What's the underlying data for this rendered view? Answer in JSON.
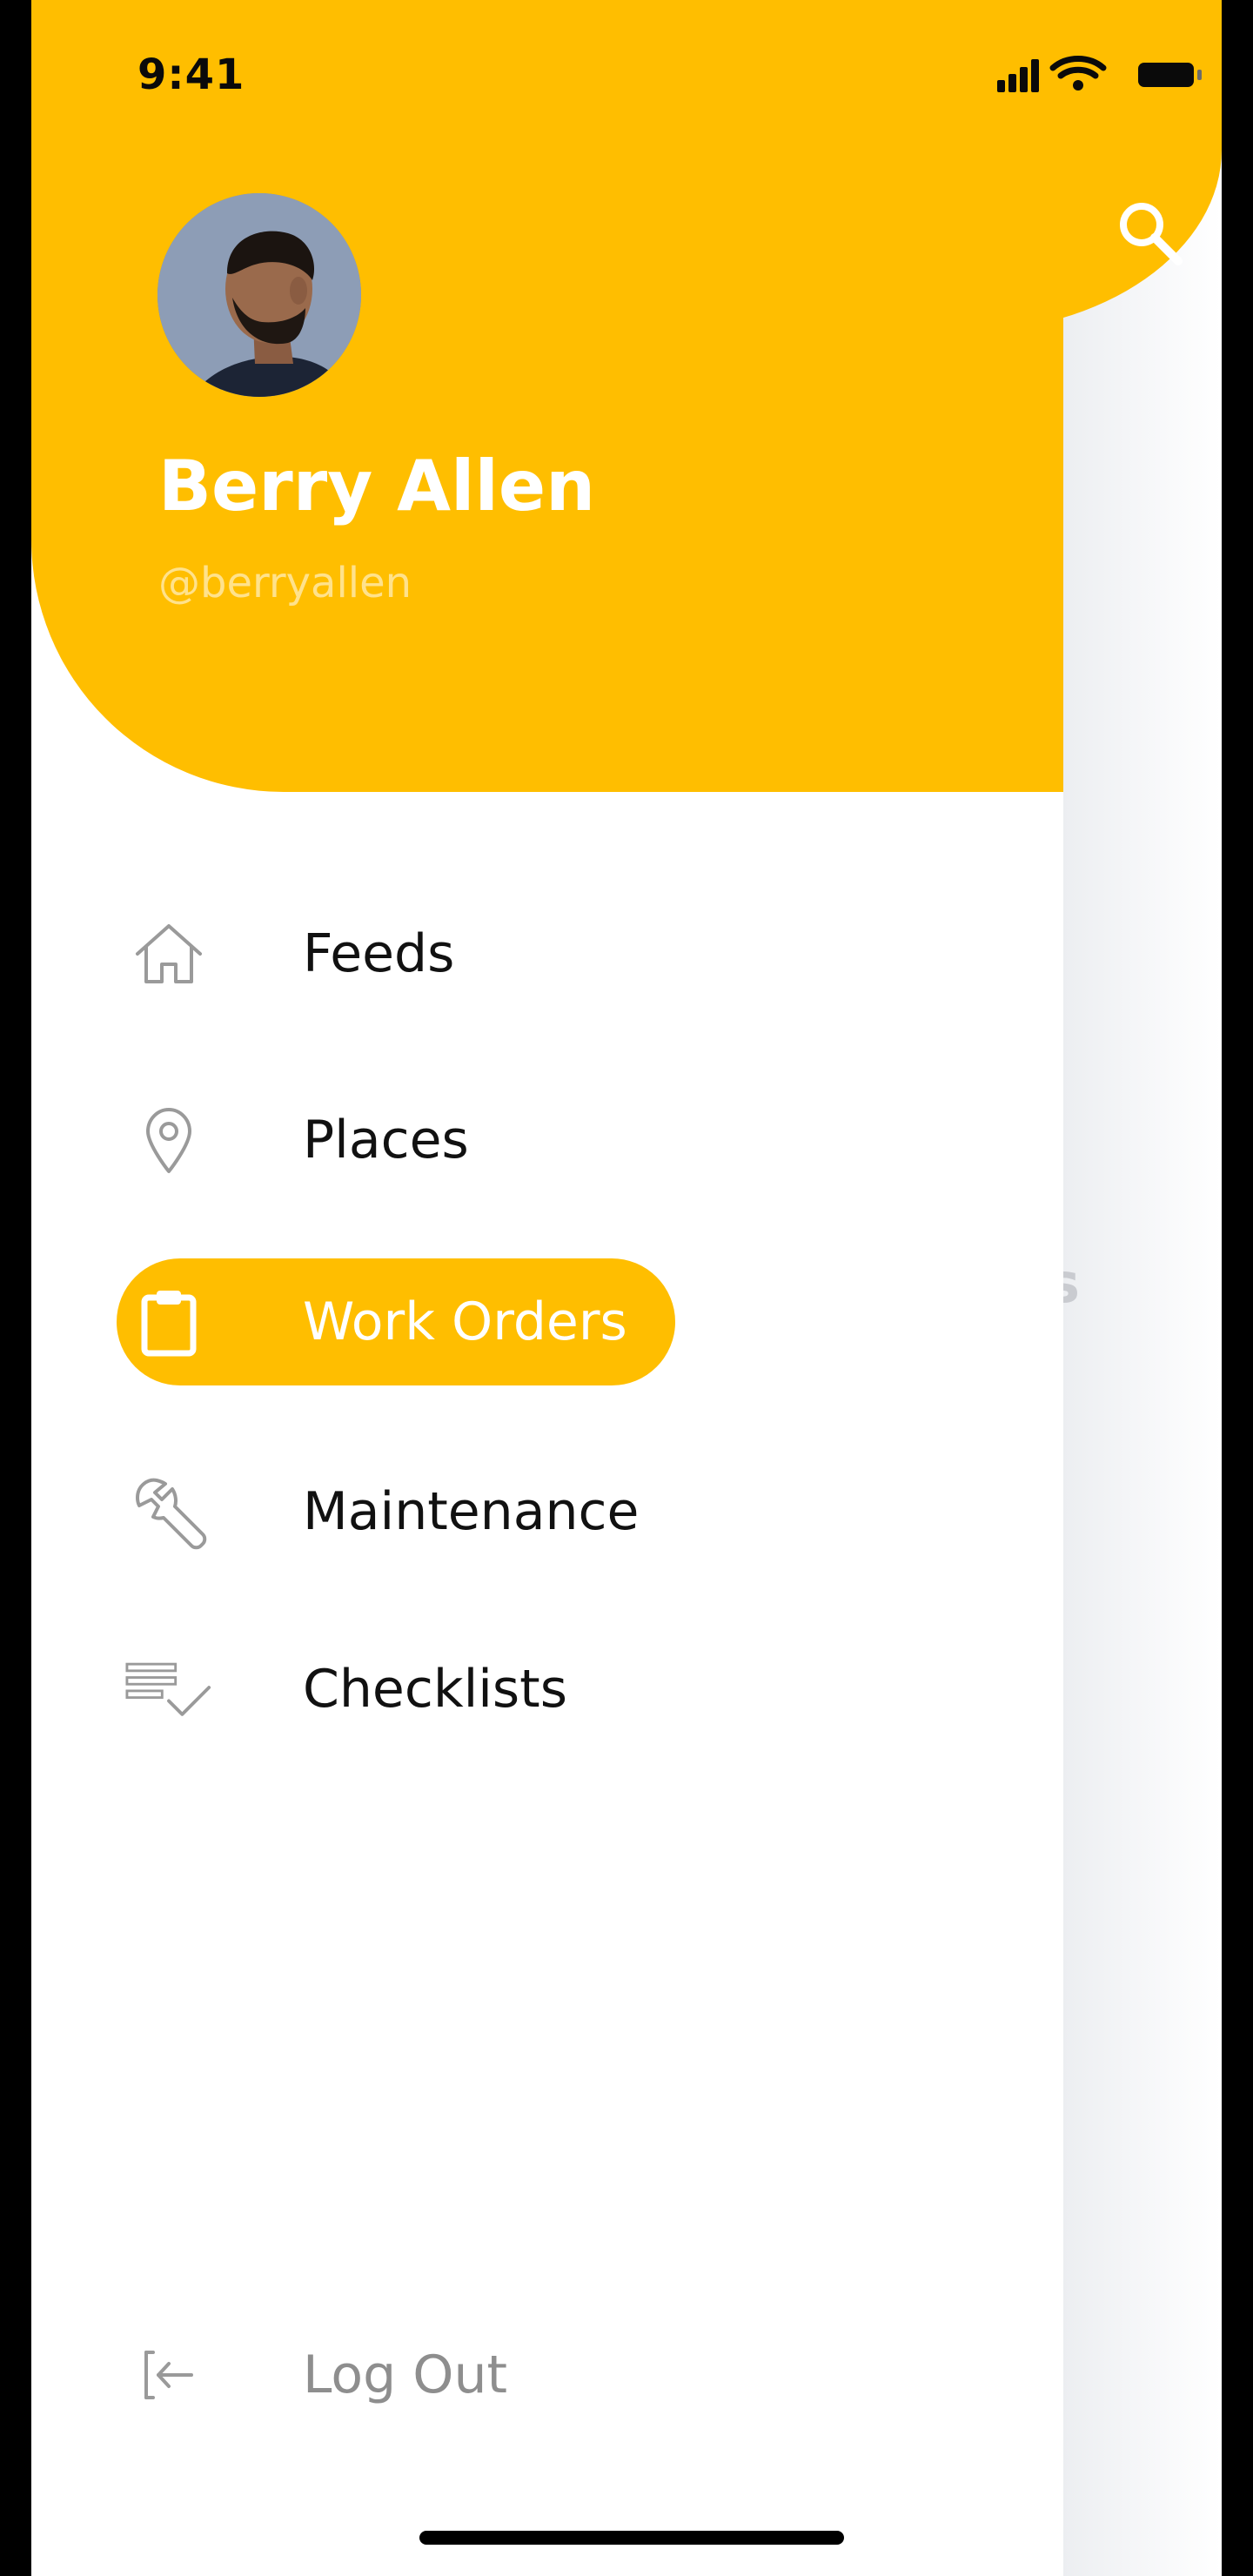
{
  "status_bar": {
    "time": "9:41"
  },
  "profile": {
    "name": "Berry Allen",
    "handle": "@berryallen"
  },
  "menu": {
    "items": [
      {
        "label": "Feeds",
        "icon": "home-icon",
        "active": false
      },
      {
        "label": "Places",
        "icon": "location-pin-icon",
        "active": false
      },
      {
        "label": "Work Orders",
        "icon": "clipboard-icon",
        "active": true
      },
      {
        "label": "Maintenance",
        "icon": "wrench-icon",
        "active": false
      },
      {
        "label": "Checklists",
        "icon": "checklist-icon",
        "active": false
      }
    ],
    "logout_label": "Log Out",
    "logout_icon": "logout-icon"
  },
  "background_screen": {
    "title_peek": "s",
    "search_icon": "search-icon"
  },
  "colors": {
    "accent": "#FFBE00",
    "text_primary": "#111111",
    "text_muted": "#8e8e8e",
    "icon_gray": "#9a9a9a"
  }
}
